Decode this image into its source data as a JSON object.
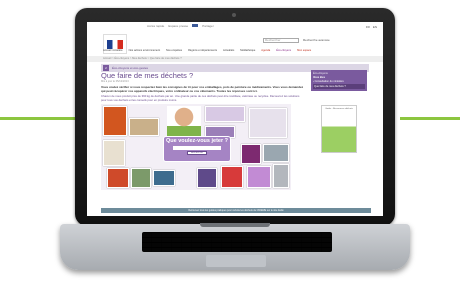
{
  "site": {
    "topbar_links": [
      "FR",
      "EN"
    ],
    "util_links": [
      "Accès rapide",
      "Espace presse",
      "Partager"
    ],
    "search_placeholder": "Rechercher",
    "search_advanced": "Recherche avancée",
    "nav": [
      "Accueil ministère",
      "Nos actions environnement",
      "Nos enquêtes",
      "Régions et départements",
      "Actualités",
      "Médiathèque",
      "Agenda",
      "Éco-citoyens",
      "Mon espace"
    ],
    "breadcrumb": "Accueil > Éco-citoyens > Mes déchets > Que faire de mes déchets ?",
    "section_title": "Éco-citoyens et éco-gestes",
    "section_number": "2"
  },
  "article": {
    "title": "Que faire de mes déchets ?",
    "date": "Mis à jour le 05/12/2013",
    "lead": "Vous voulez vérifier si vous respectez bien les consignes de tri pour vos emballages, pots de peinture ou médicaments. Vous vous demandez qui peut récupérer vos appareils électriques, votre ordinateur ou vos vêtements. Toutes les réponses sont ici.",
    "body": "Chacun de nous produit près de 390 kg de déchets par an. Une grande partie de ces déchets peut être réutilisée, valorisée ou recyclée. Découvrez les solutions pour tous vos déchets et les conseils pour en produire moins.",
    "widget_question": "Que voulez-vous jeter ?",
    "widget_placeholder": "",
    "widget_button": "Rechercher"
  },
  "sidebar": {
    "label": "Éco-citoyens",
    "title": "Vous êtes",
    "link": "› Consultation du ministère",
    "current": "Que faire de mes déchets ?",
    "promo_text": "Guide - Ressources déchets"
  },
  "footer_text": "Retrouvez tous les guides pratiques pour réduire les déchets de l'ADEME sur le site dédié",
  "colors": {
    "accent": "#8cc63f",
    "brand_purple": "#7a5a9e",
    "footer": "#6d8b9a"
  }
}
